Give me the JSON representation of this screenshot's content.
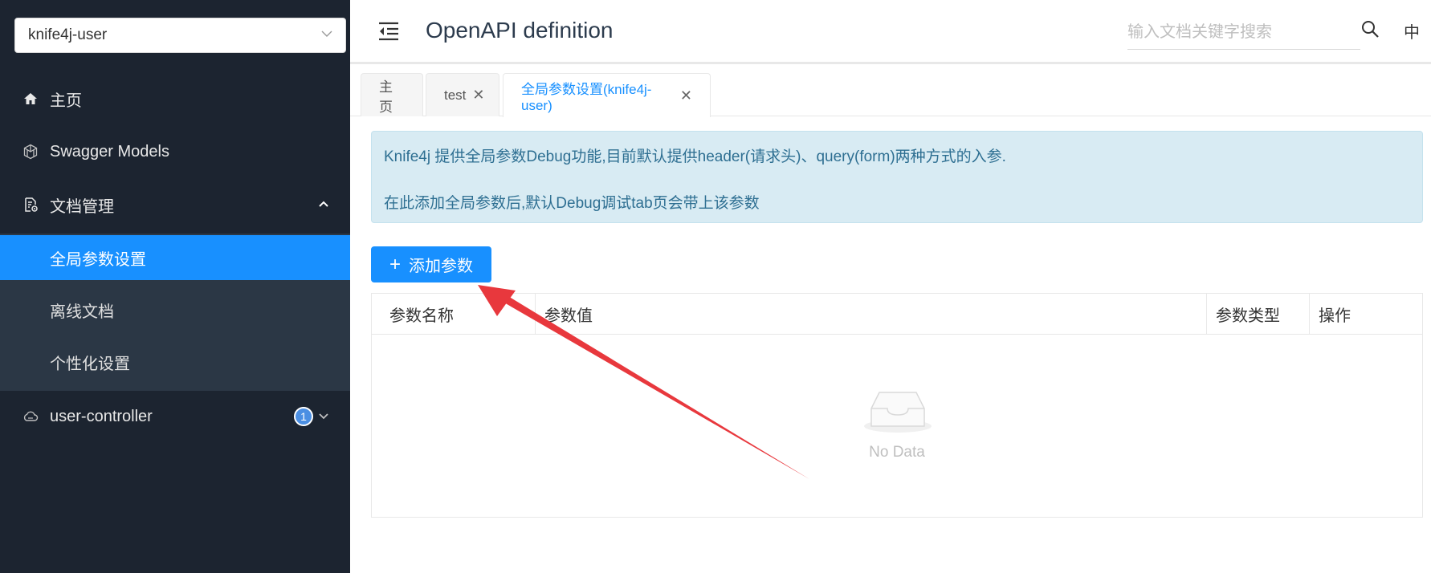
{
  "sidebar": {
    "group_select": {
      "value": "knife4j-user",
      "icon": "chevron-down-icon"
    },
    "items": [
      {
        "label": "主页",
        "icon": "home-icon"
      },
      {
        "label": "Swagger Models",
        "icon": "cube-icon"
      },
      {
        "label": "文档管理",
        "icon": "doc-settings-icon",
        "expanded": true
      },
      {
        "label": "user-controller",
        "icon": "cloud-icon",
        "badge": "1"
      }
    ],
    "submenu": [
      {
        "label": "全局参数设置",
        "active": true
      },
      {
        "label": "离线文档"
      },
      {
        "label": "个性化设置"
      }
    ]
  },
  "header": {
    "title": "OpenAPI definition",
    "search_placeholder": "输入文档关键字搜索",
    "lang": "中"
  },
  "tabs": [
    {
      "label": "主页",
      "closable": false
    },
    {
      "label": "test",
      "closable": true
    },
    {
      "label": "全局参数设置(knife4j-user)",
      "closable": true,
      "active": true
    }
  ],
  "alert": {
    "line1": "Knife4j 提供全局参数Debug功能,目前默认提供header(请求头)、query(form)两种方式的入参.",
    "line2": "在此添加全局参数后,默认Debug调试tab页会带上该参数"
  },
  "add_button": {
    "label": "添加参数"
  },
  "table": {
    "columns": [
      "参数名称",
      "参数值",
      "参数类型",
      "操作"
    ],
    "rows": [],
    "empty_text": "No Data"
  },
  "colors": {
    "sidebar_bg": "#1c2430",
    "submenu_bg": "#2b3745",
    "accent": "#1890ff",
    "alert_bg": "#d8ebf3",
    "arrow": "#e8383d"
  }
}
